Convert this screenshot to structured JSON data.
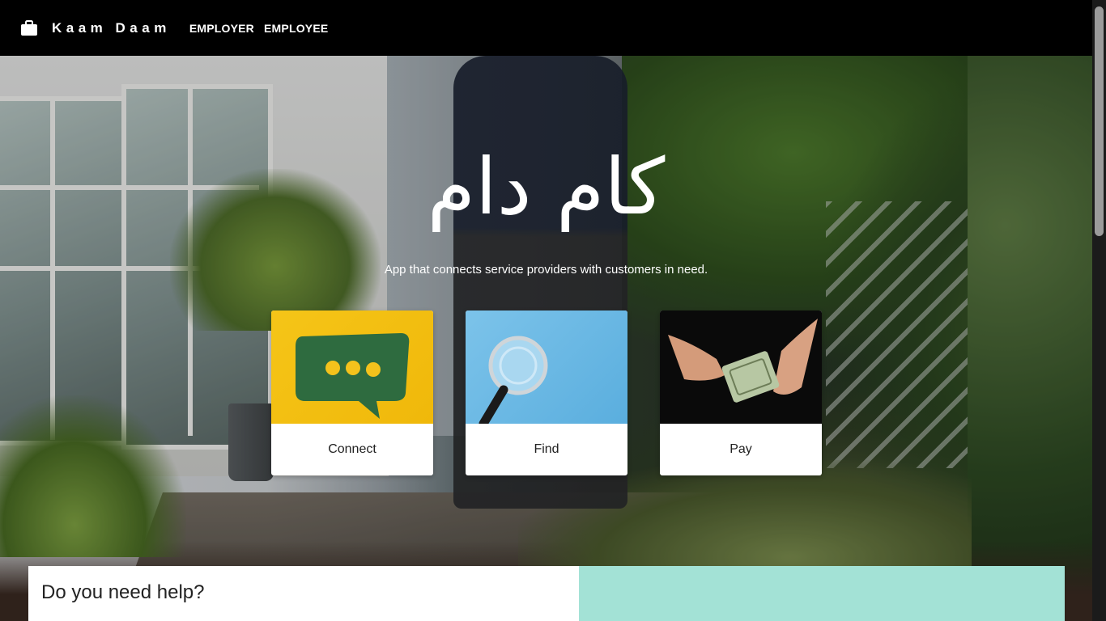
{
  "nav": {
    "brand": "Kaam Daam",
    "brand_icon": "briefcase-icon",
    "links": [
      {
        "label": "EMPLOYER"
      },
      {
        "label": "EMPLOYEE"
      }
    ]
  },
  "hero": {
    "title": "کام دام",
    "subtitle": "App that connects service providers with customers in need."
  },
  "cards": [
    {
      "label": "Connect",
      "image": "speech-bubble-icon"
    },
    {
      "label": "Find",
      "image": "magnifier-icon"
    },
    {
      "label": "Pay",
      "image": "cash-hands-icon"
    }
  ],
  "help": {
    "title": "Do you need help?"
  },
  "colors": {
    "navbar": "#000000",
    "help_accent": "#a3e2d6"
  }
}
